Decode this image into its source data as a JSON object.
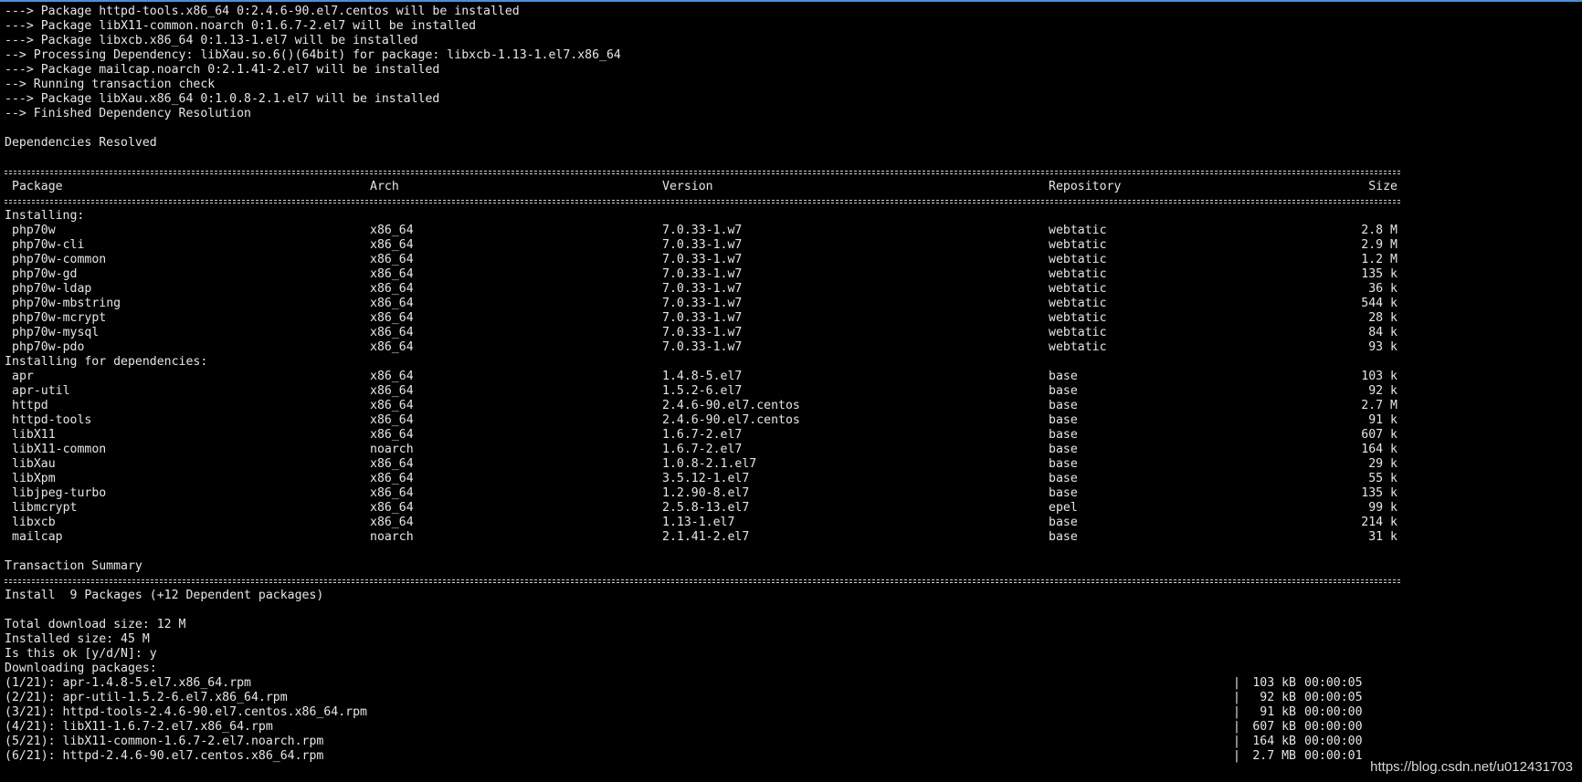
{
  "pre_lines": [
    "---> Package httpd-tools.x86_64 0:2.4.6-90.el7.centos will be installed",
    "---> Package libX11-common.noarch 0:1.6.7-2.el7 will be installed",
    "---> Package libxcb.x86_64 0:1.13-1.el7 will be installed",
    "--> Processing Dependency: libXau.so.6()(64bit) for package: libxcb-1.13-1.el7.x86_64",
    "---> Package mailcap.noarch 0:2.1.41-2.el7 will be installed",
    "--> Running transaction check",
    "---> Package libXau.x86_64 0:1.0.8-2.1.el7 will be installed",
    "--> Finished Dependency Resolution",
    "",
    "Dependencies Resolved"
  ],
  "table": {
    "headers": {
      "package": "Package",
      "arch": "Arch",
      "version": "Version",
      "repository": "Repository",
      "size": "Size"
    },
    "installing_label": "Installing:",
    "installing": [
      {
        "package": "php70w",
        "arch": "x86_64",
        "version": "7.0.33-1.w7",
        "repo": "webtatic",
        "size": "2.8 M"
      },
      {
        "package": "php70w-cli",
        "arch": "x86_64",
        "version": "7.0.33-1.w7",
        "repo": "webtatic",
        "size": "2.9 M"
      },
      {
        "package": "php70w-common",
        "arch": "x86_64",
        "version": "7.0.33-1.w7",
        "repo": "webtatic",
        "size": "1.2 M"
      },
      {
        "package": "php70w-gd",
        "arch": "x86_64",
        "version": "7.0.33-1.w7",
        "repo": "webtatic",
        "size": "135 k"
      },
      {
        "package": "php70w-ldap",
        "arch": "x86_64",
        "version": "7.0.33-1.w7",
        "repo": "webtatic",
        "size": "36 k"
      },
      {
        "package": "php70w-mbstring",
        "arch": "x86_64",
        "version": "7.0.33-1.w7",
        "repo": "webtatic",
        "size": "544 k"
      },
      {
        "package": "php70w-mcrypt",
        "arch": "x86_64",
        "version": "7.0.33-1.w7",
        "repo": "webtatic",
        "size": "28 k"
      },
      {
        "package": "php70w-mysql",
        "arch": "x86_64",
        "version": "7.0.33-1.w7",
        "repo": "webtatic",
        "size": "84 k"
      },
      {
        "package": "php70w-pdo",
        "arch": "x86_64",
        "version": "7.0.33-1.w7",
        "repo": "webtatic",
        "size": "93 k"
      }
    ],
    "deps_label": "Installing for dependencies:",
    "deps": [
      {
        "package": "apr",
        "arch": "x86_64",
        "version": "1.4.8-5.el7",
        "repo": "base",
        "size": "103 k"
      },
      {
        "package": "apr-util",
        "arch": "x86_64",
        "version": "1.5.2-6.el7",
        "repo": "base",
        "size": "92 k"
      },
      {
        "package": "httpd",
        "arch": "x86_64",
        "version": "2.4.6-90.el7.centos",
        "repo": "base",
        "size": "2.7 M"
      },
      {
        "package": "httpd-tools",
        "arch": "x86_64",
        "version": "2.4.6-90.el7.centos",
        "repo": "base",
        "size": "91 k"
      },
      {
        "package": "libX11",
        "arch": "x86_64",
        "version": "1.6.7-2.el7",
        "repo": "base",
        "size": "607 k"
      },
      {
        "package": "libX11-common",
        "arch": "noarch",
        "version": "1.6.7-2.el7",
        "repo": "base",
        "size": "164 k"
      },
      {
        "package": "libXau",
        "arch": "x86_64",
        "version": "1.0.8-2.1.el7",
        "repo": "base",
        "size": "29 k"
      },
      {
        "package": "libXpm",
        "arch": "x86_64",
        "version": "3.5.12-1.el7",
        "repo": "base",
        "size": "55 k"
      },
      {
        "package": "libjpeg-turbo",
        "arch": "x86_64",
        "version": "1.2.90-8.el7",
        "repo": "base",
        "size": "135 k"
      },
      {
        "package": "libmcrypt",
        "arch": "x86_64",
        "version": "2.5.8-13.el7",
        "repo": "epel",
        "size": "99 k"
      },
      {
        "package": "libxcb",
        "arch": "x86_64",
        "version": "1.13-1.el7",
        "repo": "base",
        "size": "214 k"
      },
      {
        "package": "mailcap",
        "arch": "noarch",
        "version": "2.1.41-2.el7",
        "repo": "base",
        "size": "31 k"
      }
    ]
  },
  "summary": {
    "title": "Transaction Summary",
    "install_line": "Install  9 Packages (+12 Dependent packages)",
    "total_download": "Total download size: 12 M",
    "installed_size": "Installed size: 45 M",
    "prompt": "Is this ok [y/d/N]: y",
    "downloading": "Downloading packages:"
  },
  "downloads": [
    {
      "file": "(1/21): apr-1.4.8-5.el7.x86_64.rpm",
      "size": "103 kB",
      "time": "00:00:05"
    },
    {
      "file": "(2/21): apr-util-1.5.2-6.el7.x86_64.rpm",
      "size": "92 kB",
      "time": "00:00:05"
    },
    {
      "file": "(3/21): httpd-tools-2.4.6-90.el7.centos.x86_64.rpm",
      "size": "91 kB",
      "time": "00:00:00"
    },
    {
      "file": "(4/21): libX11-1.6.7-2.el7.x86_64.rpm",
      "size": "607 kB",
      "time": "00:00:00"
    },
    {
      "file": "(5/21): libX11-common-1.6.7-2.el7.noarch.rpm",
      "size": "164 kB",
      "time": "00:00:00"
    },
    {
      "file": "(6/21): httpd-2.4.6-90.el7.centos.x86_64.rpm",
      "size": "2.7 MB",
      "time": "00:00:01"
    }
  ],
  "download_bar": "|",
  "watermark": "https://blog.csdn.net/u012431703",
  "colors": {
    "background": "#000000",
    "text": "#e6e6e6",
    "top_edge": "#4f8fcf"
  }
}
